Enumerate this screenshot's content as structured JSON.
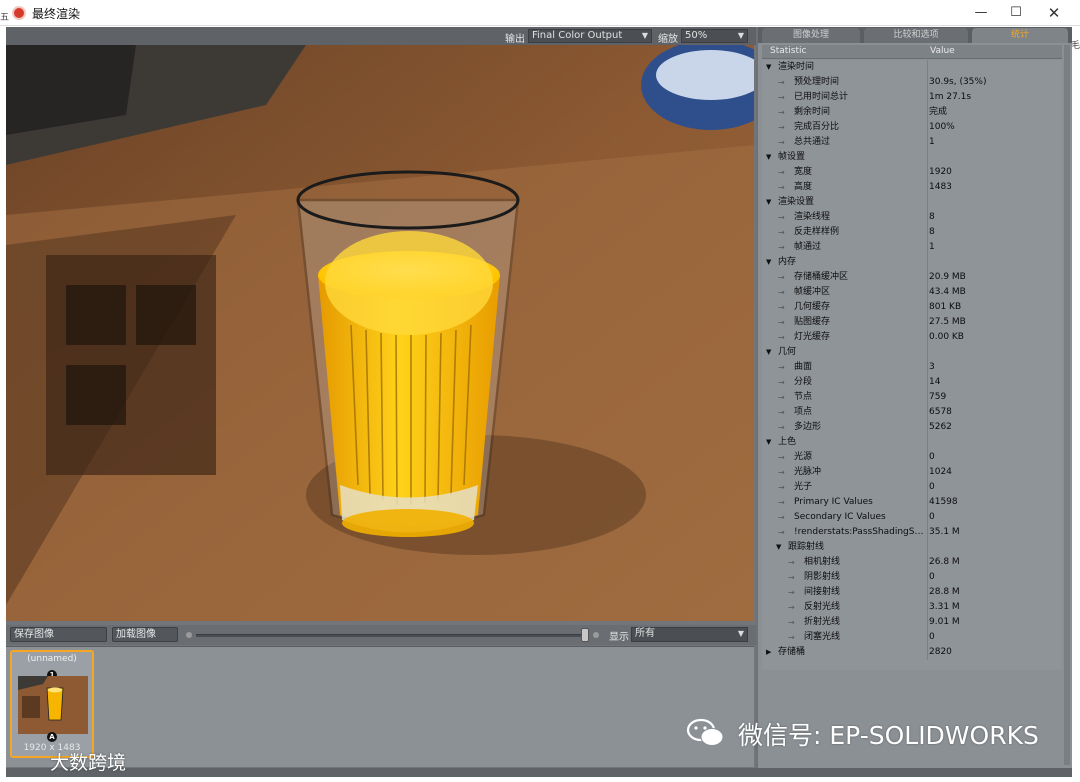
{
  "window": {
    "title": "最终渲染",
    "min": "—",
    "max": "☐",
    "close": "✕",
    "edge_left": "五",
    "edge_right": "毛"
  },
  "toolbar": {
    "output_label": "输出",
    "output_value": "Final Color Output",
    "zoom_label": "缩放",
    "zoom_value": "50%"
  },
  "controls": {
    "save_label": "保存图像",
    "load_label": "加载图像",
    "show_label": "显示",
    "show_value": "所有"
  },
  "thumbnail": {
    "name": "(unnamed)",
    "size": "1920 x 1483",
    "badge_top": "1",
    "badge_bottom": "A"
  },
  "tabs": [
    {
      "label": "图像处理",
      "active": false
    },
    {
      "label": "比较和选项",
      "active": false
    },
    {
      "label": "统计",
      "active": true
    }
  ],
  "stats": {
    "header": {
      "statistic": "Statistic",
      "value": "Value"
    },
    "rows": [
      {
        "label": "渲染时间",
        "value": "",
        "level": 0,
        "group": true,
        "open": true
      },
      {
        "label": "预处理时间",
        "value": "30.9s, (35%)",
        "level": 1
      },
      {
        "label": "已用时间总计",
        "value": "1m 27.1s",
        "level": 1
      },
      {
        "label": "剩余时间",
        "value": "完成",
        "level": 1
      },
      {
        "label": "完成百分比",
        "value": "100%",
        "level": 1
      },
      {
        "label": "总共通过",
        "value": "1",
        "level": 1
      },
      {
        "label": "帧设置",
        "value": "",
        "level": 0,
        "group": true,
        "open": true
      },
      {
        "label": "宽度",
        "value": "1920",
        "level": 1
      },
      {
        "label": "高度",
        "value": "1483",
        "level": 1
      },
      {
        "label": "渲染设置",
        "value": "",
        "level": 0,
        "group": true,
        "open": true
      },
      {
        "label": "渲染线程",
        "value": "8",
        "level": 1
      },
      {
        "label": "反走样样例",
        "value": "8",
        "level": 1
      },
      {
        "label": "帧通过",
        "value": "1",
        "level": 1
      },
      {
        "label": "内存",
        "value": "",
        "level": 0,
        "group": true,
        "open": true
      },
      {
        "label": "存储桶缓冲区",
        "value": "20.9 MB",
        "level": 1
      },
      {
        "label": "帧缓冲区",
        "value": "43.4 MB",
        "level": 1
      },
      {
        "label": "几何缓存",
        "value": "801 KB",
        "level": 1
      },
      {
        "label": "贴图缓存",
        "value": "27.5 MB",
        "level": 1
      },
      {
        "label": "灯光缓存",
        "value": "0.00 KB",
        "level": 1
      },
      {
        "label": "几何",
        "value": "",
        "level": 0,
        "group": true,
        "open": true
      },
      {
        "label": "曲面",
        "value": "3",
        "level": 1
      },
      {
        "label": "分段",
        "value": "14",
        "level": 1
      },
      {
        "label": "节点",
        "value": "759",
        "level": 1
      },
      {
        "label": "项点",
        "value": "6578",
        "level": 1
      },
      {
        "label": "多边形",
        "value": "5262",
        "level": 1
      },
      {
        "label": "上色",
        "value": "",
        "level": 0,
        "group": true,
        "open": true
      },
      {
        "label": "光源",
        "value": "0",
        "level": 1
      },
      {
        "label": "光脉冲",
        "value": "1024",
        "level": 1
      },
      {
        "label": "光子",
        "value": "0",
        "level": 1
      },
      {
        "label": "Primary IC Values",
        "value": "41598",
        "level": 1
      },
      {
        "label": "Secondary IC Values",
        "value": "0",
        "level": 1
      },
      {
        "label": "!renderstats:PassShadingShad...",
        "value": "35.1 M",
        "level": 1
      },
      {
        "label": "跟踪射线",
        "value": "",
        "level": 1,
        "group": true,
        "open": true
      },
      {
        "label": "相机射线",
        "value": "26.8 M",
        "level": 2
      },
      {
        "label": "阴影射线",
        "value": "0",
        "level": 2
      },
      {
        "label": "间接射线",
        "value": "28.8 M",
        "level": 2
      },
      {
        "label": "反射光线",
        "value": "3.31 M",
        "level": 2
      },
      {
        "label": "折射光线",
        "value": "9.01 M",
        "level": 2
      },
      {
        "label": "闭塞光线",
        "value": "0",
        "level": 2
      },
      {
        "label": "存储桶",
        "value": "2820",
        "level": 0,
        "group": true,
        "open": false
      }
    ]
  },
  "watermark": {
    "text": "微信号: EP-SOLIDWORKS",
    "left_text": "大数跨境"
  },
  "colors": {
    "accent": "#f5a623",
    "panel": "#8b9095",
    "juice": "#f7b500"
  }
}
